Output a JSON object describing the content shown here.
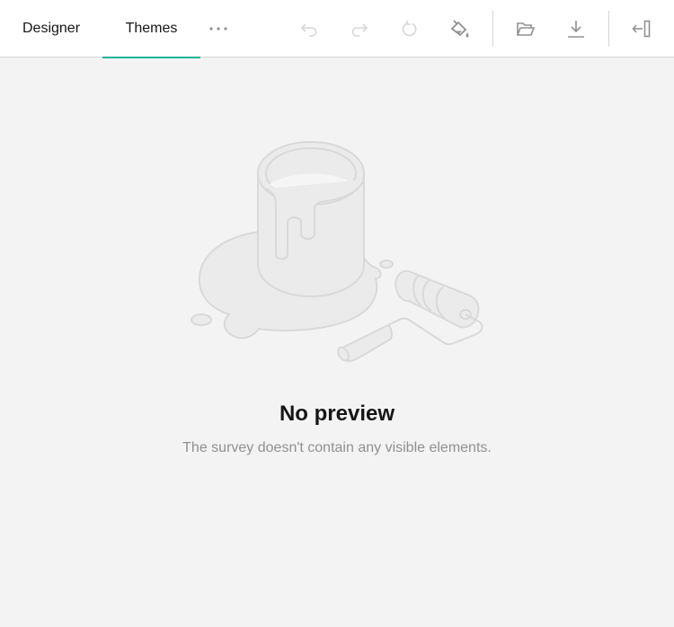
{
  "theme": {
    "accent": "#19b394"
  },
  "tabs": [
    {
      "label": "Designer",
      "active": false
    },
    {
      "label": "Themes",
      "active": true
    }
  ],
  "toolbar": {
    "more_icon": "ellipsis-icon",
    "actions": [
      {
        "name": "undo",
        "icon": "undo-icon",
        "enabled": false
      },
      {
        "name": "redo",
        "icon": "redo-icon",
        "enabled": false
      },
      {
        "name": "reset-theme",
        "icon": "reset-icon",
        "enabled": false
      },
      {
        "name": "theme-settings",
        "icon": "paint-bucket-icon",
        "enabled": true
      },
      {
        "name": "import-theme",
        "icon": "folder-open-icon",
        "enabled": true
      },
      {
        "name": "export-theme",
        "icon": "download-icon",
        "enabled": true
      },
      {
        "name": "collapse-panel",
        "icon": "collapse-panel-icon",
        "enabled": true
      }
    ]
  },
  "empty_state": {
    "illustration": "paint-bucket-and-roller-illustration",
    "title": "No preview",
    "message": "The survey doesn't contain any visible elements."
  }
}
